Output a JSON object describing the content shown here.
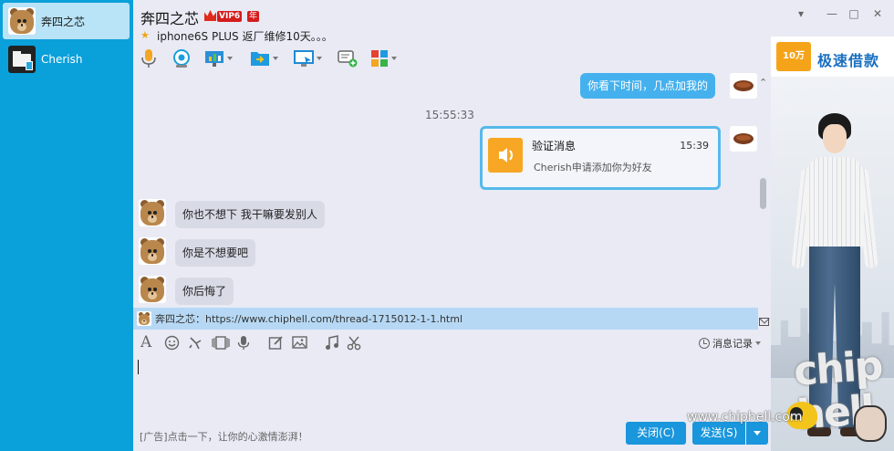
{
  "sidebar": {
    "contacts": [
      {
        "name": "奔四之芯",
        "active": true
      },
      {
        "name": "Cherish",
        "active": false
      }
    ]
  },
  "header": {
    "contact_name": "奔四之芯",
    "vip_label": "VIP6",
    "vip_year_label": "年",
    "signature": "iphone6S PLUS 返厂维修10天。。。"
  },
  "window_controls": {
    "dropdown": "▾",
    "minimize": "—",
    "maximize": "□",
    "close": "✕"
  },
  "chat": {
    "messages": [
      {
        "side": "right",
        "text": "你看下时间，几点加我的"
      },
      {
        "side": "time",
        "text": "15:55:33"
      },
      {
        "side": "right-card",
        "title": "验证消息",
        "time": "15:39",
        "text": "Cherish申请添加你为好友"
      },
      {
        "side": "left",
        "text": "你也不想下 我干嘛要发别人"
      },
      {
        "side": "left",
        "text": "你是不想要吧"
      },
      {
        "side": "left",
        "text": "你后悔了"
      }
    ]
  },
  "link_bar": {
    "text": "奔四之芯：https://www.chiphell.com/thread-1715012-1-1.html"
  },
  "input_toolbar": {
    "font": "A",
    "history_label": "消息记录"
  },
  "footer": {
    "ad_text": "[广告]点击一下，让你的心激情澎湃！",
    "close_label": "关闭(C)",
    "send_label": "发送(S)"
  },
  "ad_panel": {
    "logo_text": "10万",
    "title": "极速借款"
  },
  "watermark": {
    "url": "www.chiphell.com",
    "brand": "chip hell"
  },
  "colors": {
    "sidebar": "#0aa0da",
    "accent": "#1996dc",
    "bubble_right": "#44b1ee",
    "bubble_left": "#d8dbe6",
    "link_bar": "#b6d8f4"
  }
}
